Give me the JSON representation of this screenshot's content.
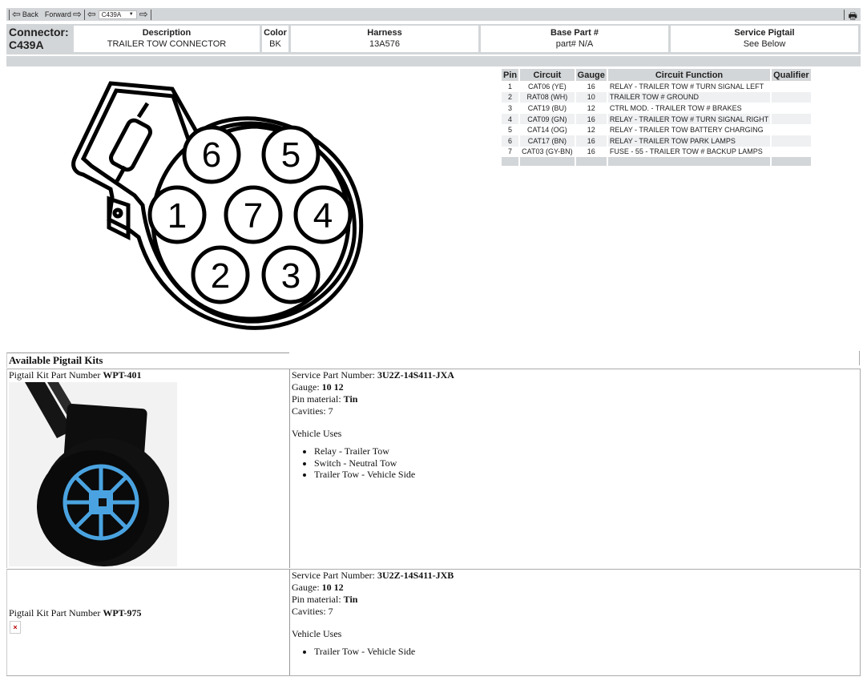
{
  "toolbar": {
    "back_label": "Back",
    "forward_label": "Forward",
    "connector_select_value": "C439A",
    "print_icon": "printer-icon"
  },
  "connector_header": {
    "label_line1": "Connector:",
    "label_line2": "C439A",
    "fields": [
      {
        "heading": "Description",
        "value": "TRAILER TOW CONNECTOR"
      },
      {
        "heading": "Color",
        "value": "BK"
      },
      {
        "heading": "Harness",
        "value": "13A576"
      },
      {
        "heading": "Base Part #",
        "value": "part# N/A"
      },
      {
        "heading": "Service Pigtail",
        "value": "See Below"
      }
    ]
  },
  "pin_table": {
    "headers": [
      "Pin",
      "Circuit",
      "Gauge",
      "Circuit Function",
      "Qualifier"
    ],
    "rows": [
      {
        "pin": "1",
        "circuit": "CAT06 (YE)",
        "gauge": "16",
        "function": "RELAY - TRAILER TOW # TURN SIGNAL LEFT",
        "qualifier": ""
      },
      {
        "pin": "2",
        "circuit": "RAT08 (WH)",
        "gauge": "10",
        "function": "TRAILER TOW # GROUND",
        "qualifier": ""
      },
      {
        "pin": "3",
        "circuit": "CAT19 (BU)",
        "gauge": "12",
        "function": "CTRL MOD. - TRAILER TOW # BRAKES",
        "qualifier": ""
      },
      {
        "pin": "4",
        "circuit": "CAT09 (GN)",
        "gauge": "16",
        "function": "RELAY - TRAILER TOW # TURN SIGNAL RIGHT",
        "qualifier": ""
      },
      {
        "pin": "5",
        "circuit": "CAT14 (OG)",
        "gauge": "12",
        "function": "RELAY - TRAILER TOW BATTERY CHARGING",
        "qualifier": ""
      },
      {
        "pin": "6",
        "circuit": "CAT17 (BN)",
        "gauge": "16",
        "function": "RELAY - TRAILER TOW PARK LAMPS",
        "qualifier": ""
      },
      {
        "pin": "7",
        "circuit": "CAT03 (GY-BN)",
        "gauge": "16",
        "function": "FUSE - 55 - TRAILER TOW # BACKUP LAMPS",
        "qualifier": ""
      }
    ]
  },
  "diagram": {
    "pin_labels": [
      "1",
      "2",
      "3",
      "4",
      "5",
      "6",
      "7"
    ]
  },
  "pigtail": {
    "title": "Available Pigtail Kits",
    "kits": [
      {
        "label": "Pigtail Kit Part Number ",
        "part_number": "WPT-401",
        "service_part_label": "Service Part Number: ",
        "service_part": "3U2Z-14S411-JXA",
        "gauge_label": "Gauge: ",
        "gauge": "10 12",
        "pin_material_label": "Pin material: ",
        "pin_material": "Tin",
        "cavities_label": "Cavities: ",
        "cavities": "7",
        "uses_title": "Vehicle Uses",
        "uses": [
          "Relay - Trailer Tow",
          "Switch - Neutral Tow",
          "Trailer Tow - Vehicle Side"
        ],
        "image": "connector-photo"
      },
      {
        "label": "Pigtail Kit Part Number ",
        "part_number": "WPT-975",
        "service_part_label": "Service Part Number: ",
        "service_part": "3U2Z-14S411-JXB",
        "gauge_label": "Gauge: ",
        "gauge": "10 12",
        "pin_material_label": "Pin material: ",
        "pin_material": "Tin",
        "cavities_label": "Cavities: ",
        "cavities": "7",
        "uses_title": "Vehicle Uses",
        "uses": [
          "Trailer Tow - Vehicle Side"
        ],
        "image": "broken-image",
        "broken_glyph": "×"
      }
    ]
  }
}
